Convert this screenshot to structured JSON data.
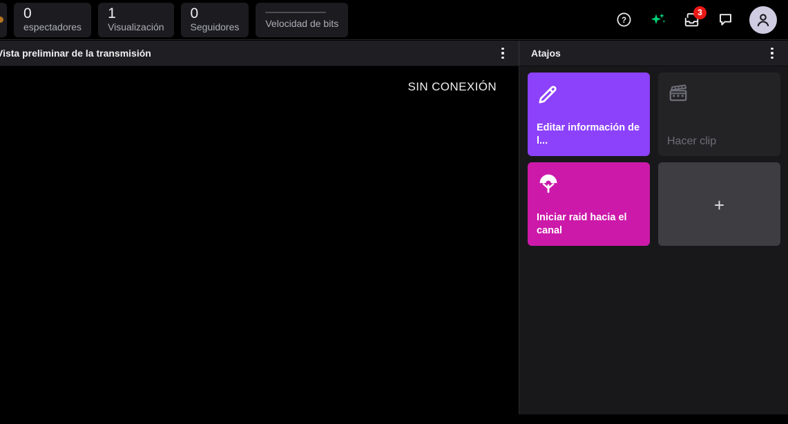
{
  "topbar": {
    "stats": [
      {
        "value": "0",
        "label": "espectadores",
        "icon": "viewers-stat"
      },
      {
        "value": "1",
        "label": "Visualización",
        "icon": "views-stat"
      },
      {
        "value": "0",
        "label": "Seguidores",
        "icon": "followers-stat"
      },
      {
        "value": "",
        "label": "Velocidad de bits",
        "icon": "bitrate-stat"
      }
    ],
    "icons": [
      {
        "name": "help-icon",
        "glyph": "?"
      },
      {
        "name": "sparkle-icon",
        "color": "#00d17a"
      },
      {
        "name": "inbox-icon",
        "badge": "3",
        "badge_color": "#e91916"
      },
      {
        "name": "chat-bubble-icon"
      },
      {
        "name": "avatar",
        "avatar_bg": "#cfcbe0"
      }
    ]
  },
  "panels": {
    "preview": {
      "title": "Vista preliminar de la transmisión",
      "status": "SIN CONEXIÓN",
      "menu_icon": "kebab-menu-icon"
    },
    "shortcuts": {
      "title": "Atajos",
      "menu_icon": "kebab-menu-icon",
      "cards": [
        {
          "label": "Editar información de l...",
          "icon": "pencil-icon",
          "bg": "#8c41fb",
          "state": "enabled"
        },
        {
          "label": "Hacer clip",
          "icon": "clapperboard-icon",
          "bg": "#232326",
          "state": "disabled"
        },
        {
          "label": "Iniciar raid hacia el canal",
          "icon": "raid-parachute-icon",
          "bg": "#cc19aa",
          "state": "enabled"
        },
        {
          "label": "+",
          "icon": "plus-icon",
          "bg": "#3d3d42",
          "state": "add"
        }
      ]
    }
  },
  "annotation": {
    "name": "red-arrow-pointer",
    "fill": "#fb4a3f",
    "stroke": "#000000",
    "points_to": "add-shortcut-card"
  }
}
